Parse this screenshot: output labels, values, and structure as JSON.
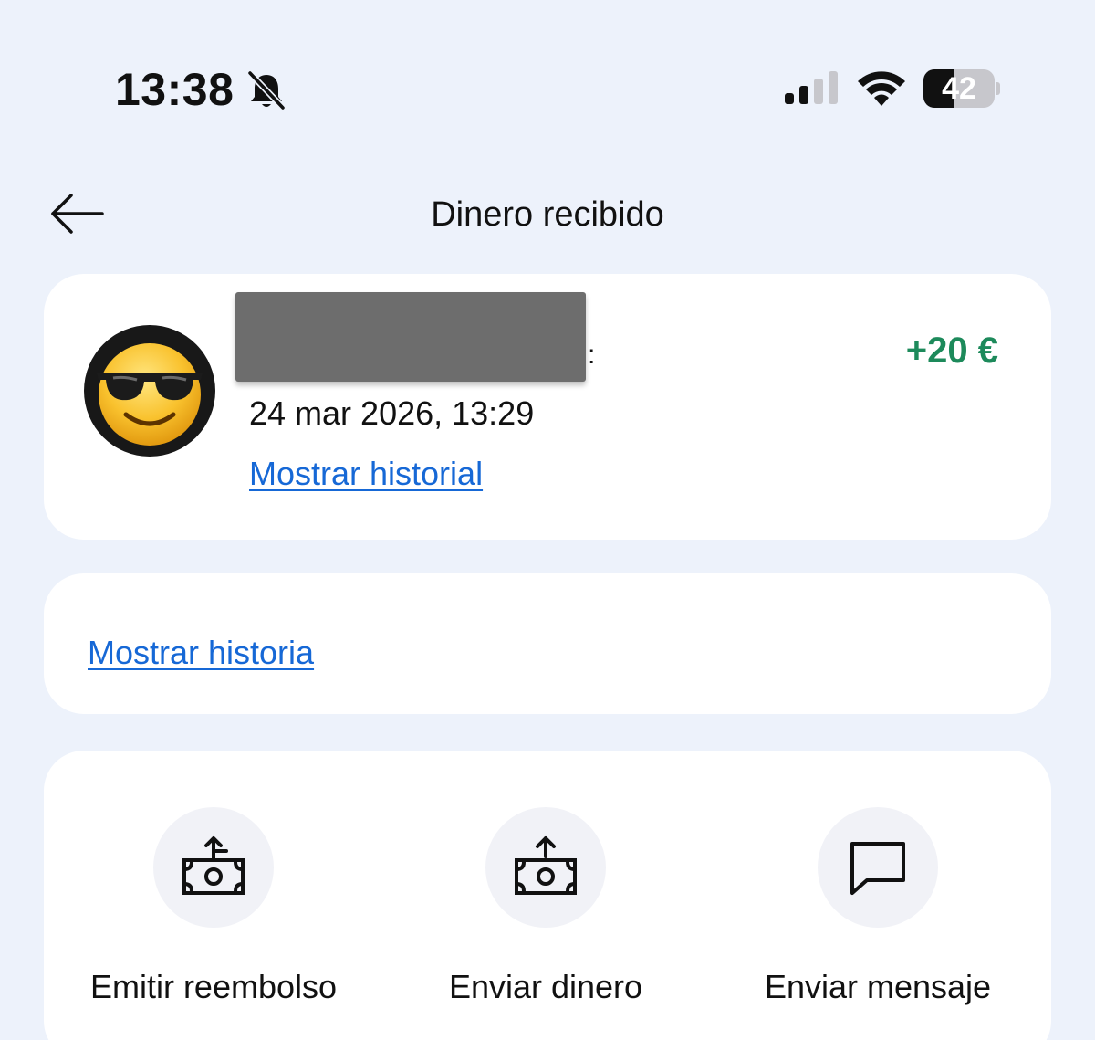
{
  "status_bar": {
    "time": "13:38",
    "battery_level": "42",
    "battery_fraction": 0.42,
    "icons": [
      "bell-slash-icon",
      "cellular-signal-icon",
      "wifi-icon",
      "battery-icon"
    ]
  },
  "header": {
    "title": "Dinero recibido",
    "back_icon": "arrow-left-icon"
  },
  "transaction": {
    "sender_name_tail": ":",
    "amount": "+20 €",
    "amount_color": "#1d8a5b",
    "date": "24 mar 2026, 13:29",
    "history_link": "Mostrar historial",
    "avatar_icon": "sunglasses-emoji-icon"
  },
  "history_card": {
    "link": "Mostrar historia"
  },
  "actions": [
    {
      "label": "Emitir reembolso",
      "icon": "money-return-icon"
    },
    {
      "label": "Enviar dinero",
      "icon": "money-send-icon"
    },
    {
      "label": "Enviar mensaje",
      "icon": "message-icon"
    }
  ],
  "colors": {
    "background": "#edf2fb",
    "link": "#1668d6",
    "card": "#ffffff"
  }
}
